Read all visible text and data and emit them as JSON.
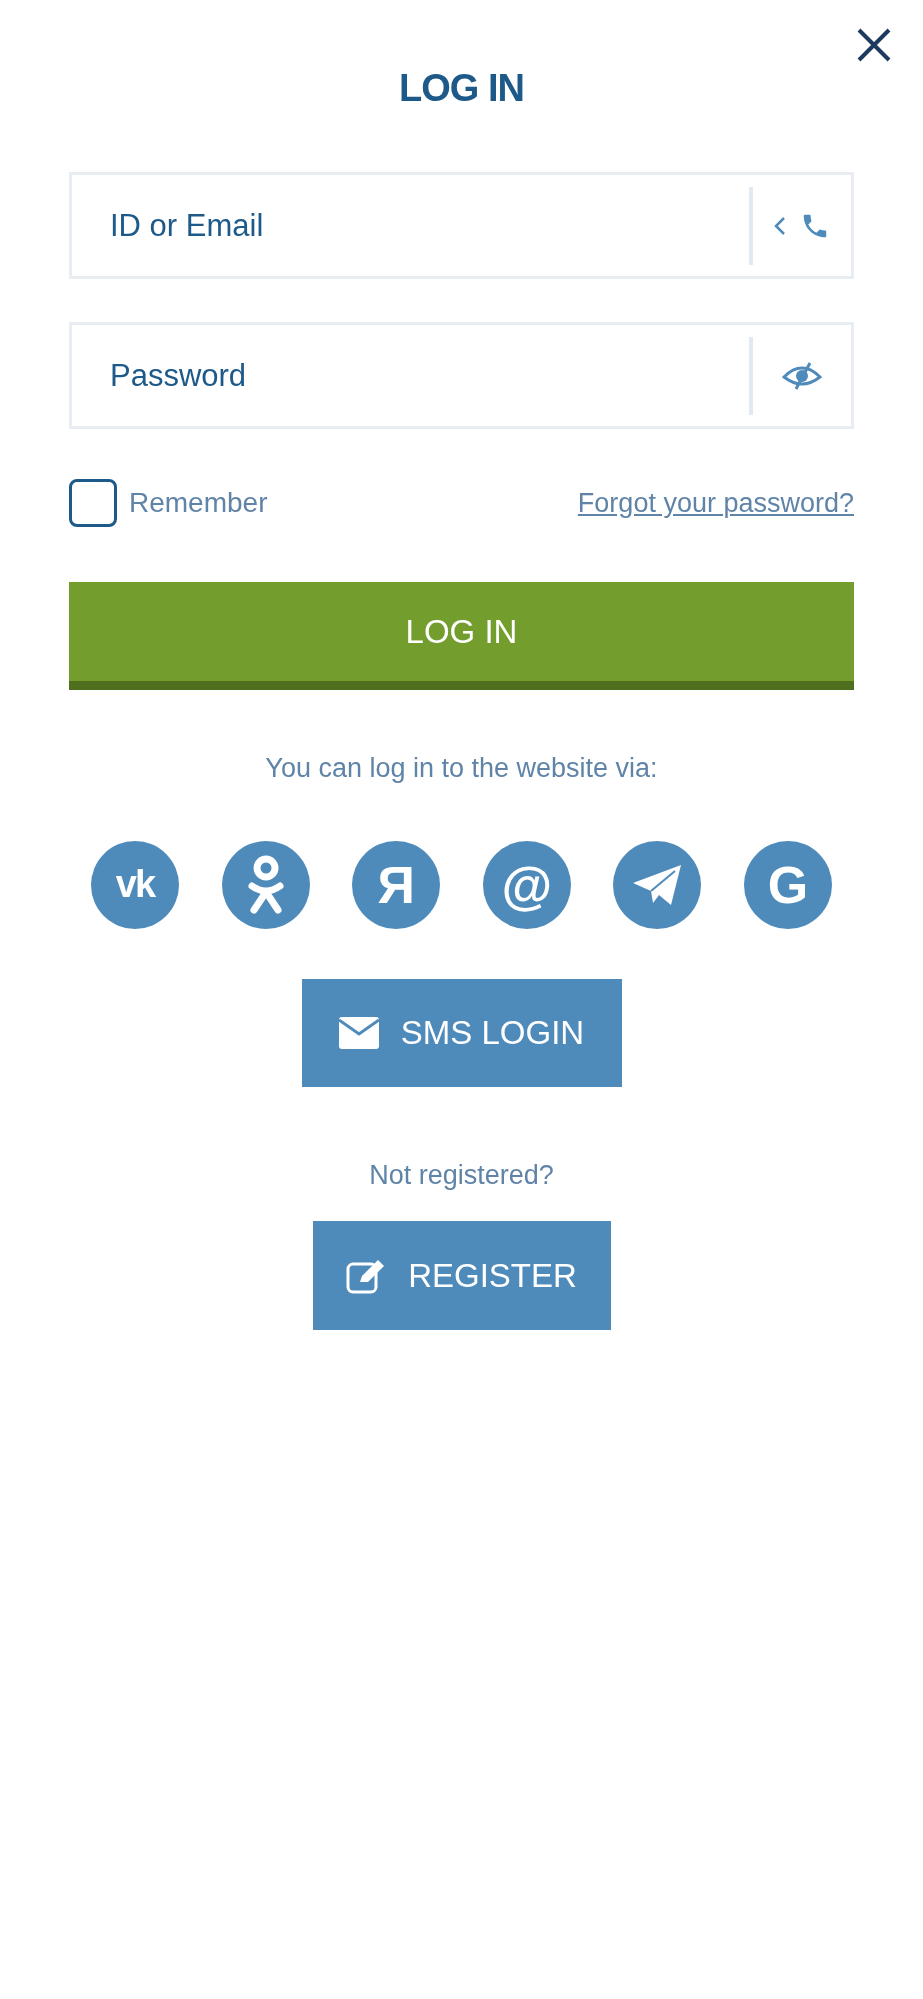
{
  "title": "LOG IN",
  "fields": [
    {
      "kind": "login",
      "placeholder": "ID or Email"
    },
    {
      "kind": "password",
      "placeholder": "Password"
    }
  ],
  "remember": {
    "label": "Remember",
    "checked": false
  },
  "forgot_link": "Forgot your password?",
  "login_button": "LOG IN",
  "social_caption": "You can log in to the website via:",
  "social": [
    {
      "kind": "vk",
      "glyph": "vk"
    },
    {
      "kind": "ok"
    },
    {
      "kind": "letter",
      "glyph": "Я"
    },
    {
      "kind": "letter",
      "glyph": "@"
    },
    {
      "kind": "telegram"
    },
    {
      "kind": "letter",
      "glyph": "G"
    }
  ],
  "sms_button": "SMS LOGIN",
  "register_prompt": "Not registered?",
  "register_button": "REGISTER"
}
